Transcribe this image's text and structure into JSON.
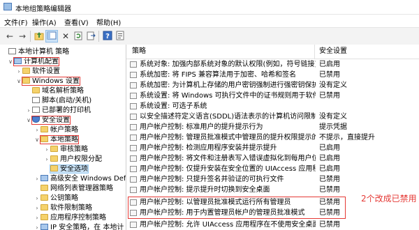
{
  "window": {
    "title": "本地组策略编辑器"
  },
  "menu": [
    "文件(F)",
    "操作(A)",
    "查看(V)",
    "帮助(H)"
  ],
  "toolbar": {
    "back_icon": "arrow-left-icon",
    "forward_icon": "arrow-right-icon",
    "up_icon": "folder-up-icon",
    "show_tree_icon": "console-tree-icon",
    "delete_icon": "delete-icon",
    "refresh_icon": "refresh-icon",
    "export_icon": "export-icon",
    "help_icon": "help-icon",
    "properties_icon": "properties-icon"
  },
  "tree": [
    {
      "label": "本地计算机 策略"
    },
    {
      "label": "计算机配置"
    },
    {
      "label": "软件设置"
    },
    {
      "label": "Windows 设置"
    },
    {
      "label": "域名解析策略"
    },
    {
      "label": "脚本(启动/关机)"
    },
    {
      "label": "已部署的打印机"
    },
    {
      "label": "安全设置"
    },
    {
      "label": "帐户策略"
    },
    {
      "label": "本地策略"
    },
    {
      "label": "审核策略"
    },
    {
      "label": "用户权限分配"
    },
    {
      "label": "安全选项"
    },
    {
      "label": "高级安全 Windows Def"
    },
    {
      "label": "网络列表管理器策略"
    },
    {
      "label": "公钥策略"
    },
    {
      "label": "软件限制策略"
    },
    {
      "label": "应用程序控制策略"
    },
    {
      "label": "IP 安全策略，在 本地计"
    }
  ],
  "table": {
    "columns": [
      "策略",
      "安全设置"
    ],
    "rows": [
      {
        "name": "系统对象: 加强内部系统对象的默认权限(例如，符号链接)",
        "setting": "已启用"
      },
      {
        "name": "系统加密: 将 FIPS 兼容算法用于加密、哈希和签名",
        "setting": "已禁用"
      },
      {
        "name": "系统加密: 为计算机上存储的用户密钥强制进行强密钥保护",
        "setting": "没有定义"
      },
      {
        "name": "系统设置: 将 Windows 可执行文件中的证书规则用于软件限...",
        "setting": "已禁用"
      },
      {
        "name": "系统设置: 可选子系统",
        "setting": ""
      },
      {
        "name": "以安全描述符定义语言(SDDL)语法表示的计算机访问限制",
        "setting": "没有定义"
      },
      {
        "name": "用户帐户控制: 标准用户的提升提示行为",
        "setting": "提示凭据"
      },
      {
        "name": "用户帐户控制: 管理员批准模式中管理员的提升权限提示的...",
        "setting": "不提示，直接提升"
      },
      {
        "name": "用户帐户控制: 检测应用程序安装并提示提升",
        "setting": "已启用"
      },
      {
        "name": "用户帐户控制: 将文件和注册表写入错误虚拟化到每用户位置",
        "setting": "已启用"
      },
      {
        "name": "用户帐户控制: 仅提升安装在安全位置的 UIAccess 应用程序",
        "setting": "已启用"
      },
      {
        "name": "用户帐户控制: 只提升签名并验证的可执行文件",
        "setting": "已禁用"
      },
      {
        "name": "用户帐户控制: 提示提升时切换到安全桌面",
        "setting": "已禁用"
      },
      {
        "name": "用户帐户控制: 以管理员批准模式运行所有管理员",
        "setting": "已禁用"
      },
      {
        "name": "用户帐户控制: 用于内置管理员帐户的管理员批准模式",
        "setting": "已禁用"
      },
      {
        "name": "用户帐户控制: 允许 UIAccess 应用程序在不使用安全桌面的...",
        "setting": "已禁用"
      }
    ]
  },
  "annotation": "2个改成已禁用",
  "colors": {
    "highlight": "#e53935",
    "selection": "#cce4f7"
  }
}
